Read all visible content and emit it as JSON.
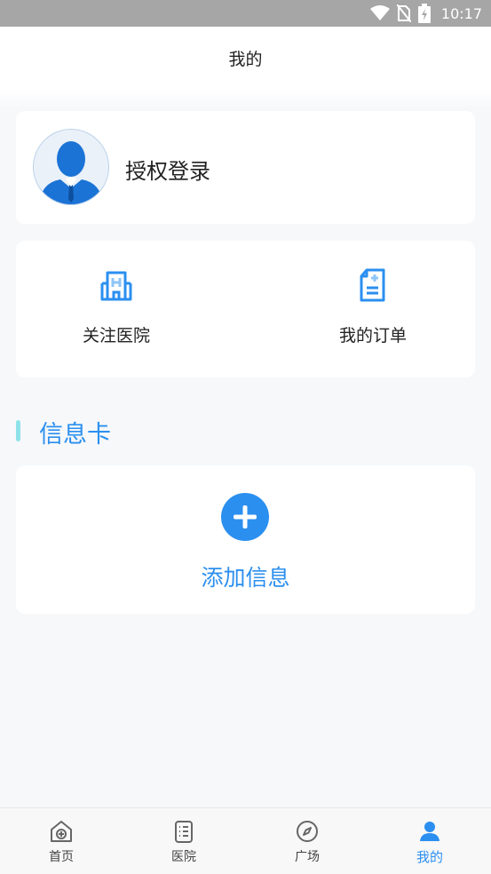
{
  "status_bar": {
    "time": "10:17"
  },
  "header": {
    "title": "我的"
  },
  "profile": {
    "login_label": "授权登录"
  },
  "shortcuts": {
    "followed_hospitals": "关注医院",
    "my_orders": "我的订单"
  },
  "info_section": {
    "title": "信息卡",
    "add_label": "添加信息"
  },
  "tabs": [
    {
      "label": "首页",
      "icon": "home-icon"
    },
    {
      "label": "医院",
      "icon": "clipboard-icon"
    },
    {
      "label": "广场",
      "icon": "compass-icon"
    },
    {
      "label": "我的",
      "icon": "user-icon",
      "active": true
    }
  ],
  "colors": {
    "accent": "#2b8ff0",
    "section_bar": "#8ee3ea"
  }
}
